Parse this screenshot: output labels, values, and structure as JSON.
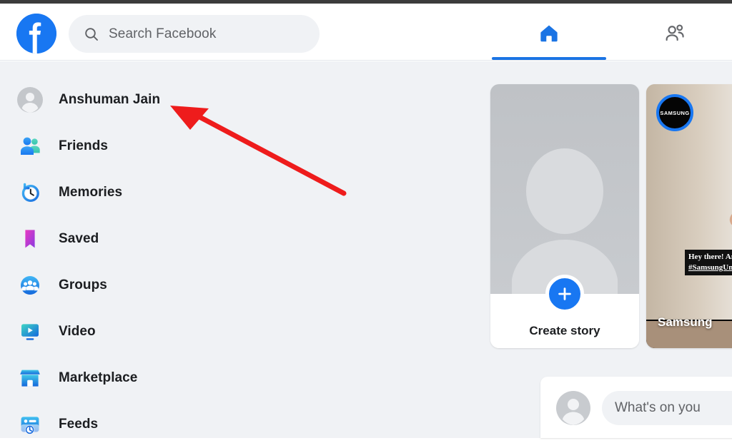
{
  "header": {
    "logo_icon": "facebook-logo-icon",
    "search": {
      "icon": "search-icon",
      "placeholder": "Search Facebook",
      "value": ""
    },
    "tabs": [
      {
        "name": "home",
        "icon": "home-icon",
        "active": true
      },
      {
        "name": "friends",
        "icon": "friends-icon",
        "active": false
      }
    ]
  },
  "sidebar": {
    "items": [
      {
        "label": "Anshuman Jain",
        "icon": "profile-avatar-icon"
      },
      {
        "label": "Friends",
        "icon": "friends-icon"
      },
      {
        "label": "Memories",
        "icon": "memories-clock-icon"
      },
      {
        "label": "Saved",
        "icon": "saved-bookmark-icon"
      },
      {
        "label": "Groups",
        "icon": "groups-icon"
      },
      {
        "label": "Video",
        "icon": "video-play-icon"
      },
      {
        "label": "Marketplace",
        "icon": "marketplace-storefront-icon"
      },
      {
        "label": "Feeds",
        "icon": "feeds-icon"
      }
    ]
  },
  "stories": {
    "create": {
      "label": "Create story",
      "plus_icon": "plus-icon",
      "avatar_icon": "profile-avatar-icon"
    },
    "items": [
      {
        "name": "Samsung",
        "avatar_label": "SAMSUNG",
        "caption_line1": "Hey there! Are you",
        "caption_line2": "#SamsungUnpa"
      }
    ]
  },
  "composer": {
    "avatar_icon": "profile-avatar-icon",
    "placeholder": "What's on you"
  },
  "annotation": {
    "type": "arrow",
    "color": "#EE1C1C",
    "points_to": "Anshuman Jain"
  },
  "colors": {
    "brand_blue": "#1877F2",
    "active_blue": "#1B74E4",
    "surface": "#F0F2F5",
    "card": "#FFFFFF",
    "text_primary": "#1C1E21",
    "text_secondary": "#606266",
    "annotation_red": "#EE1C1C"
  }
}
